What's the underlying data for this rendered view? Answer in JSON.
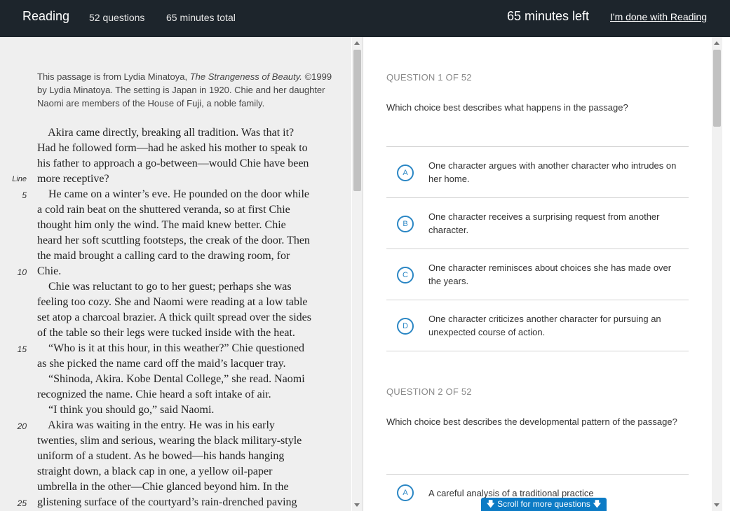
{
  "header": {
    "section": "Reading",
    "questions": "52 questions",
    "total_time": "65 minutes total",
    "time_left": "65 minutes left",
    "done_link": "I'm done with Reading"
  },
  "passage": {
    "intro_prefix": "This passage is from Lydia Minatoya, ",
    "intro_title": "The Strangeness of Beauty.",
    "intro_rest": "©1999 by Lydia Minatoya. The setting is Japan in 1920. Chie and her daughter Naomi are members of the House of Fuji, a noble family.",
    "line_label": "Line",
    "lines": [
      "    Akira came directly, breaking all tradition. Was that it?",
      "Had he followed form—had he asked his mother to speak to",
      "his father to approach a go-between—would Chie have been",
      "more receptive?",
      "    He came on a winter’s eve. He pounded on the door while",
      "a cold rain beat on the shuttered veranda, so at first Chie",
      "thought him only the wind. The maid knew better. Chie",
      "heard her soft scuttling footsteps, the creak of the door. Then",
      "the maid brought a calling card to the drawing room, for",
      "Chie.",
      "    Chie was reluctant to go to her guest; perhaps she was",
      "feeling too cozy. She and Naomi were reading at a low table",
      "set atop a charcoal brazier. A thick quilt spread over the sides",
      "of the table so their legs were tucked inside with the heat.",
      "    “Who is it at this hour, in this weather?” Chie questioned",
      "as she picked the name card off the maid’s lacquer tray.",
      "    “Shinoda, Akira. Kobe Dental College,” she read. Naomi",
      "recognized the name. Chie heard a soft intake of air.",
      "    “I think you should go,” said Naomi.",
      "    Akira was waiting in the entry. He was in his early",
      "twenties, slim and serious, wearing the black military-style",
      "uniform of a student. As he bowed—his hands hanging",
      "straight down, a black cap in one, a yellow oil-paper",
      "umbrella in the other—Chie glanced beyond him. In the",
      "glistening surface of the courtyard’s rain-drenched paving"
    ],
    "line_numbers": [
      "5",
      "10",
      "15",
      "20",
      "25"
    ]
  },
  "questions": [
    {
      "header": "QUESTION 1 OF 52",
      "stem": "Which choice best describes what happens in the passage?",
      "choices": [
        {
          "letter": "A",
          "text": "One character argues with another character who intrudes on her home."
        },
        {
          "letter": "B",
          "text": "One character receives a surprising request from another character."
        },
        {
          "letter": "C",
          "text": "One character reminisces about choices she has made over the years."
        },
        {
          "letter": "D",
          "text": "One character criticizes another character for pursuing an unexpected course of action."
        }
      ]
    },
    {
      "header": "QUESTION 2 OF 52",
      "stem": "Which choice best describes the developmental pattern of the passage?",
      "choices": [
        {
          "letter": "A",
          "text": "A careful analysis of a traditional practice"
        }
      ]
    }
  ],
  "scroll_hint": "Scroll for more questions",
  "colors": {
    "header_bg": "#1d252c",
    "accent": "#2a86c4",
    "button": "#0c7bc5",
    "passage_bg": "#efefef"
  }
}
